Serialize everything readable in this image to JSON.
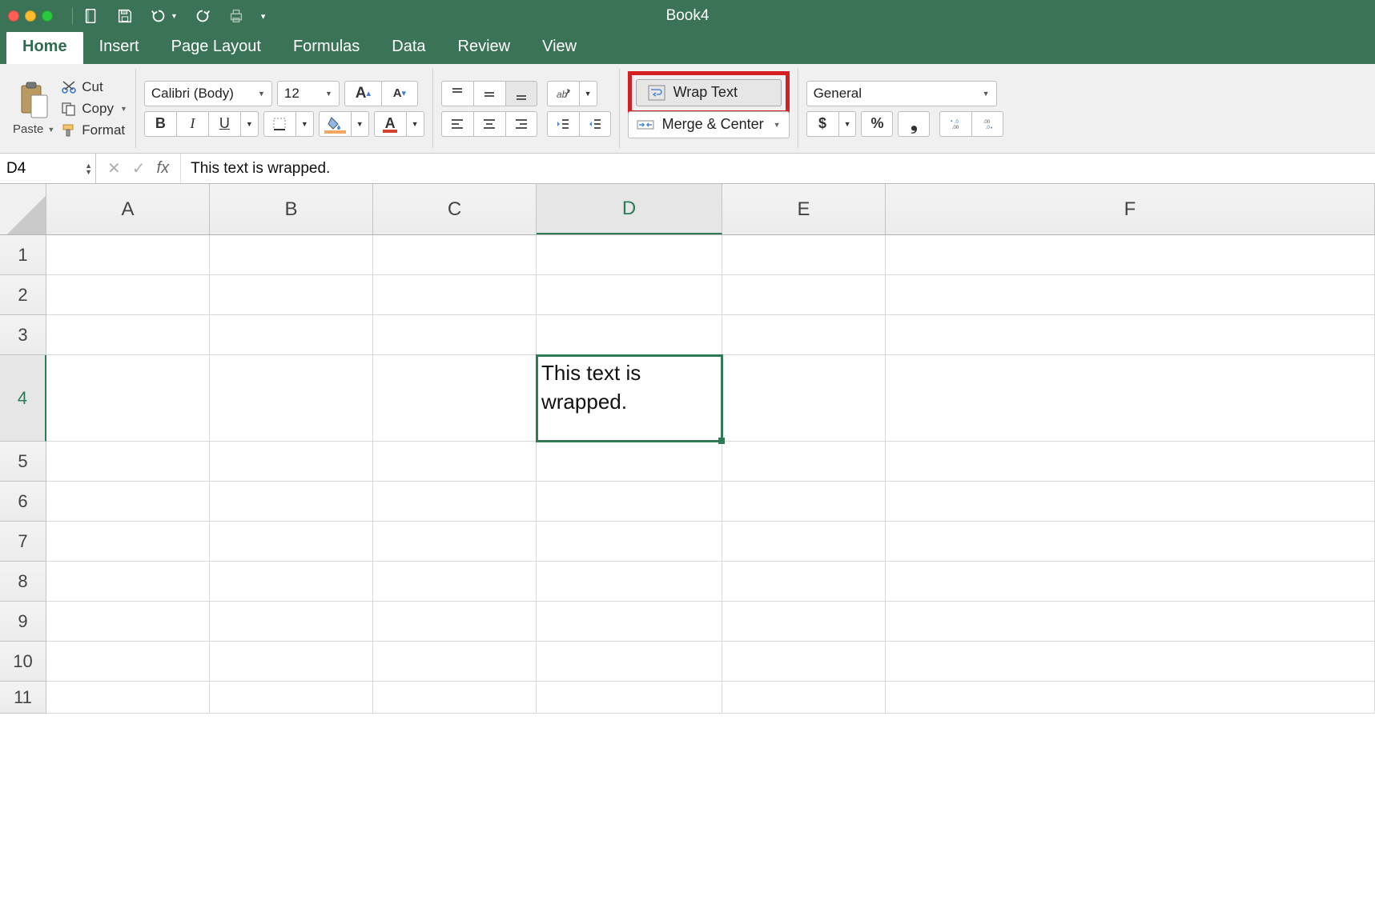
{
  "title": "Book4",
  "tabs": [
    "Home",
    "Insert",
    "Page Layout",
    "Formulas",
    "Data",
    "Review",
    "View"
  ],
  "active_tab": "Home",
  "clipboard": {
    "paste": "Paste",
    "cut": "Cut",
    "copy": "Copy",
    "format": "Format"
  },
  "font": {
    "name": "Calibri (Body)",
    "size": "12"
  },
  "wrap": "Wrap Text",
  "merge": "Merge & Center",
  "number_format": "General",
  "name_box": "D4",
  "formula": "This text is wrapped.",
  "columns": [
    "A",
    "B",
    "C",
    "D",
    "E",
    "F"
  ],
  "rows": [
    "1",
    "2",
    "3",
    "4",
    "5",
    "6",
    "7",
    "8",
    "9",
    "10",
    "11"
  ],
  "active_cell": {
    "row": "4",
    "col": "D",
    "value": "This text is wrapped."
  },
  "colors": {
    "accent": "#3a7356",
    "selection": "#2f7b55",
    "highlight_border": "#d42020"
  }
}
